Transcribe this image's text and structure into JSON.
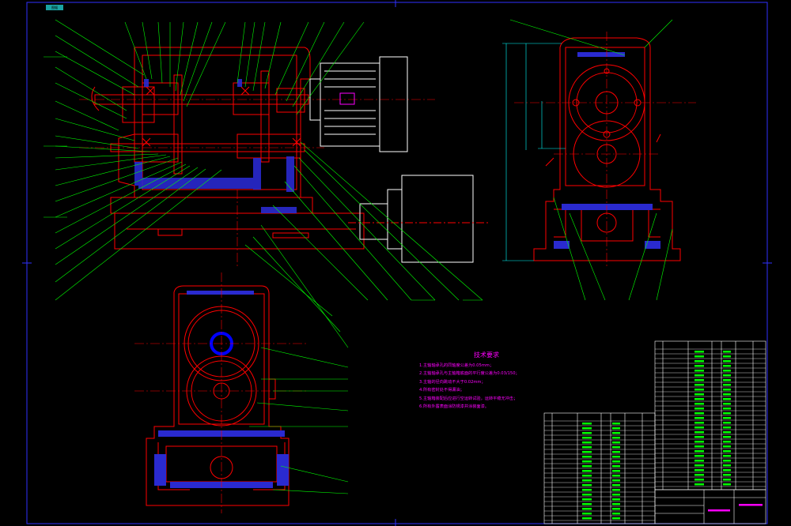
{
  "drawing": {
    "corner_tag": "图幅",
    "notes_title": "技术要求",
    "notes": [
      "1.主轴轴承孔的同轴度公差为0.05mm；",
      "2.主轴轴承孔与主轴箱底面的平行度公差为0.03/150；",
      "3.主轴的径向跳动不大于0.02mm；",
      "4.所有密封处不得漏油；",
      "5.主轴箱装配后应进行空运转试验，运转平稳无冲击；",
      "6.所有外露表面涂防锈漆并涂装面漆。"
    ],
    "colors": {
      "outline": "#ff0000",
      "leader": "#00ff00",
      "centerline": "#ff0000",
      "hatch": "#3030ff",
      "bore": "#0000ff",
      "motor": "#ffffff",
      "frame": "#3030ff",
      "notes": "#ff00ff",
      "dimension": "#00ffff"
    }
  }
}
